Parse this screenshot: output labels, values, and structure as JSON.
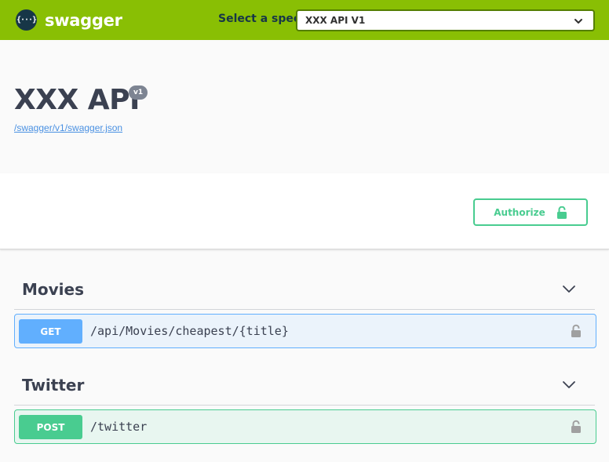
{
  "topbar": {
    "logo_glyph": "{···}",
    "brand": "swagger",
    "spec_label": "Select a spec",
    "spec_value": "XXX API V1"
  },
  "info": {
    "title": "XXX API",
    "version": "v1",
    "spec_url": "/swagger/v1/swagger.json"
  },
  "scheme": {
    "authorize_label": "Authorize"
  },
  "tags": [
    {
      "name": "Movies",
      "operations": [
        {
          "method": "GET",
          "path": "/api/Movies/cheapest/{title}"
        }
      ]
    },
    {
      "name": "Twitter",
      "operations": [
        {
          "method": "POST",
          "path": "/twitter"
        }
      ]
    }
  ],
  "colors": {
    "topbar": "#89bf04",
    "get": "#61affe",
    "post": "#49cc90",
    "text": "#3b4151",
    "link": "#4990e2"
  },
  "icons": {
    "logo": "swagger-logo-icon",
    "select_chevron": "chevron-down-icon",
    "authorize": "unlock-icon",
    "tag_toggle": "chevron-down-icon",
    "operation_lock": "lock-icon"
  }
}
